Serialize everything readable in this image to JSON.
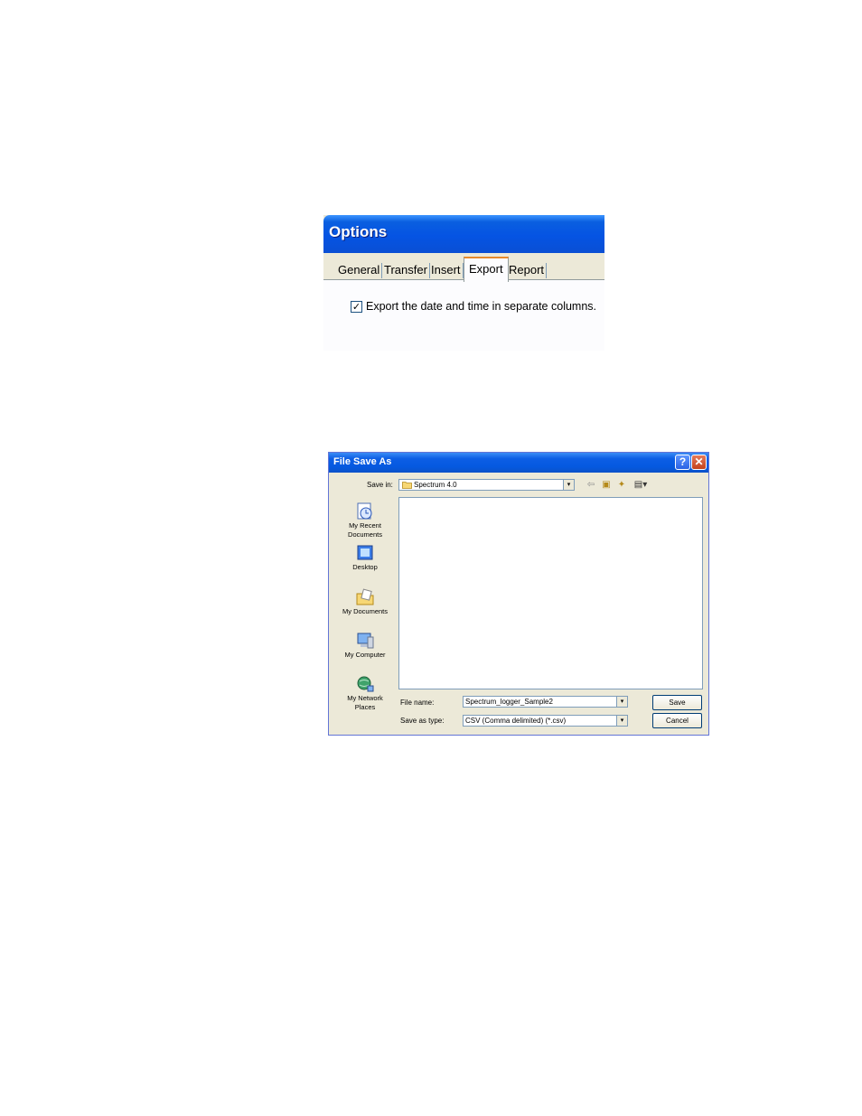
{
  "options_dialog": {
    "title": "Options",
    "tabs": [
      {
        "label": "General",
        "active": false
      },
      {
        "label": "Transfer",
        "active": false
      },
      {
        "label": "Insert",
        "active": false
      },
      {
        "label": "Export",
        "active": true
      },
      {
        "label": "Report",
        "active": false
      }
    ],
    "checkbox": {
      "checked": true,
      "check_glyph": "✓",
      "label": "Export the date and time in separate columns."
    }
  },
  "save_dialog": {
    "title": "File Save As",
    "help_glyph": "?",
    "close_glyph": "✕",
    "save_in_label": "Save in:",
    "save_in_value": "Spectrum 4.0",
    "dropdown_glyph": "▾",
    "toolbar": {
      "back_glyph": "⇦",
      "up_glyph": "▣",
      "new_folder_glyph": "✦",
      "view_glyph": "▤▾"
    },
    "places": [
      {
        "label1": "My Recent",
        "label2": "Documents",
        "icon": "recent-documents-icon"
      },
      {
        "label1": "Desktop",
        "label2": "",
        "icon": "desktop-icon"
      },
      {
        "label1": "My Documents",
        "label2": "",
        "icon": "my-documents-icon"
      },
      {
        "label1": "My Computer",
        "label2": "",
        "icon": "my-computer-icon"
      },
      {
        "label1": "My Network",
        "label2": "Places",
        "icon": "network-places-icon"
      }
    ],
    "file_name_label": "File name:",
    "file_name_value": "Spectrum_logger_Sample2",
    "save_as_type_label": "Save as type:",
    "save_as_type_value": "CSV (Comma delimited) (*.csv)",
    "save_button": "Save",
    "cancel_button": "Cancel"
  }
}
